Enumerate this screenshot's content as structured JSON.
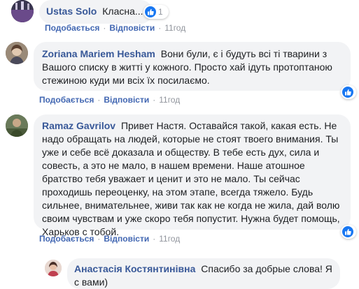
{
  "comments": [
    {
      "author": "Ustas Solo",
      "text": "Класна...",
      "reaction_count": "1",
      "actions": {
        "like": "Подобається",
        "reply": "Відповісти",
        "time": "11год"
      }
    },
    {
      "author": "Zoriana Mariem Hesham",
      "text": "Вони були, є і будуть всі ті тварини з Вашого списку в житті у кожного. Просто хай ідуть протоптаною стежиною куди ми всіх їх посилаємо.",
      "actions": {
        "like": "Подобається",
        "reply": "Відповісти",
        "time": "11год"
      }
    },
    {
      "author": "Ramaz Gavrilov",
      "text": "Привет Настя. Оставайся такой, какая есть. Не надо обращать на людей, которые не стоят твоего внимания. Ты уже и себе всё доказала и обществу. В тебе есть дух, сила и совесть, а это не мало, в нашем времени. Наше атошное братство тебя уважает и ценит и это не мало. Ты сейчас проходишь переоценку, на этом этапе, всегда тяжело. Будь сильнее, внимательнее, живи так как не когда не жила, дай волю своим чувствам и уже скоро тебя попустит. Нужна будет помощь, Харьков с тобой.",
      "actions": {
        "like": "Подобається",
        "reply": "Відповісти",
        "time": "11год"
      }
    }
  ],
  "reply": {
    "author": "Анастасія Костянтинівна",
    "text": "Спасибо за добрые слова! Я с вами)"
  },
  "colors": {
    "link": "#4267b2",
    "author": "#385898",
    "bubble": "#f2f3f5",
    "meta": "#90949c",
    "like": "#1877f2"
  }
}
